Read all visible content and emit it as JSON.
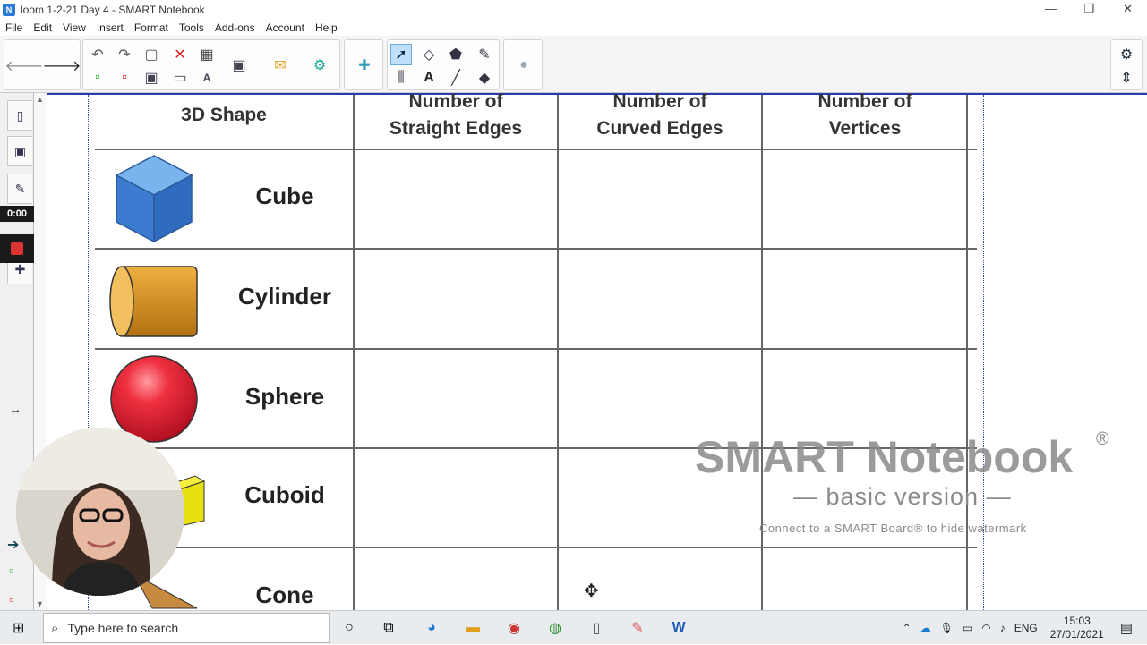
{
  "window": {
    "title": "loom 1-2-21 Day 4 - SMART Notebook",
    "minimize": "—",
    "restore": "❐",
    "close": "✕"
  },
  "menu": [
    "File",
    "Edit",
    "View",
    "Insert",
    "Format",
    "Tools",
    "Add-ons",
    "Account",
    "Help"
  ],
  "recorder": {
    "time": "0:00"
  },
  "table": {
    "headers": {
      "shape": "3D Shape",
      "straight_1": "Number of",
      "straight_2": "Straight Edges",
      "curved_1": "Number of",
      "curved_2": "Curved Edges",
      "vertices_1": "Number of",
      "vertices_2": "Vertices"
    },
    "rows": [
      "Cube",
      "Cylinder",
      "Sphere",
      "Cuboid",
      "Cone"
    ]
  },
  "watermark": {
    "title": "SMART Notebook",
    "reg": "®",
    "subtitle": "— basic version —",
    "note": "Connect to a SMART Board® to hide watermark"
  },
  "taskbar": {
    "search_placeholder": "Type here to search",
    "lang": "ENG",
    "time": "15:03",
    "date": "27/01/2021"
  },
  "colors": {
    "accent": "#2a3bb0",
    "cube": "#3b82d6",
    "cylinder": "#e0a030",
    "sphere": "#e02030",
    "cuboid": "#e8e010"
  }
}
